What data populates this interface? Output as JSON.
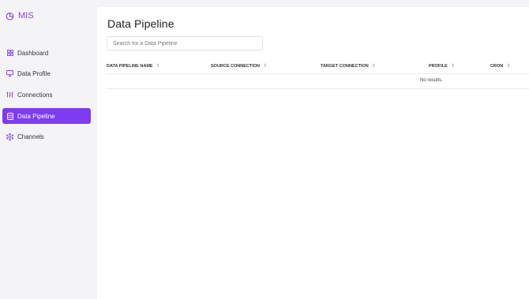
{
  "app": {
    "brand": "MIS",
    "brand_color": "#8a3ff0",
    "accent": "#7d3cf0"
  },
  "sidebar": {
    "items": [
      {
        "label": "Dashboard",
        "icon": "grid-icon",
        "active": false
      },
      {
        "label": "Data Profile",
        "icon": "monitor-icon",
        "active": false
      },
      {
        "label": "Connections",
        "icon": "sliders-icon",
        "active": false
      },
      {
        "label": "Data Pipeline",
        "icon": "database-icon",
        "active": true
      },
      {
        "label": "Channels",
        "icon": "share-network-icon",
        "active": false
      }
    ]
  },
  "main": {
    "title": "Data Pipeline",
    "search": {
      "placeholder": "Search for a Data Pipeline",
      "value": ""
    },
    "table": {
      "columns": [
        {
          "label": "DATA PIPELINE NAME"
        },
        {
          "label": "SOURCE CONNECTION"
        },
        {
          "label": "TARGET CONNECTION"
        },
        {
          "label": "PROFILE"
        },
        {
          "label": "CRON"
        }
      ],
      "sort_glyph": "⇕",
      "empty_text": "No results."
    }
  }
}
